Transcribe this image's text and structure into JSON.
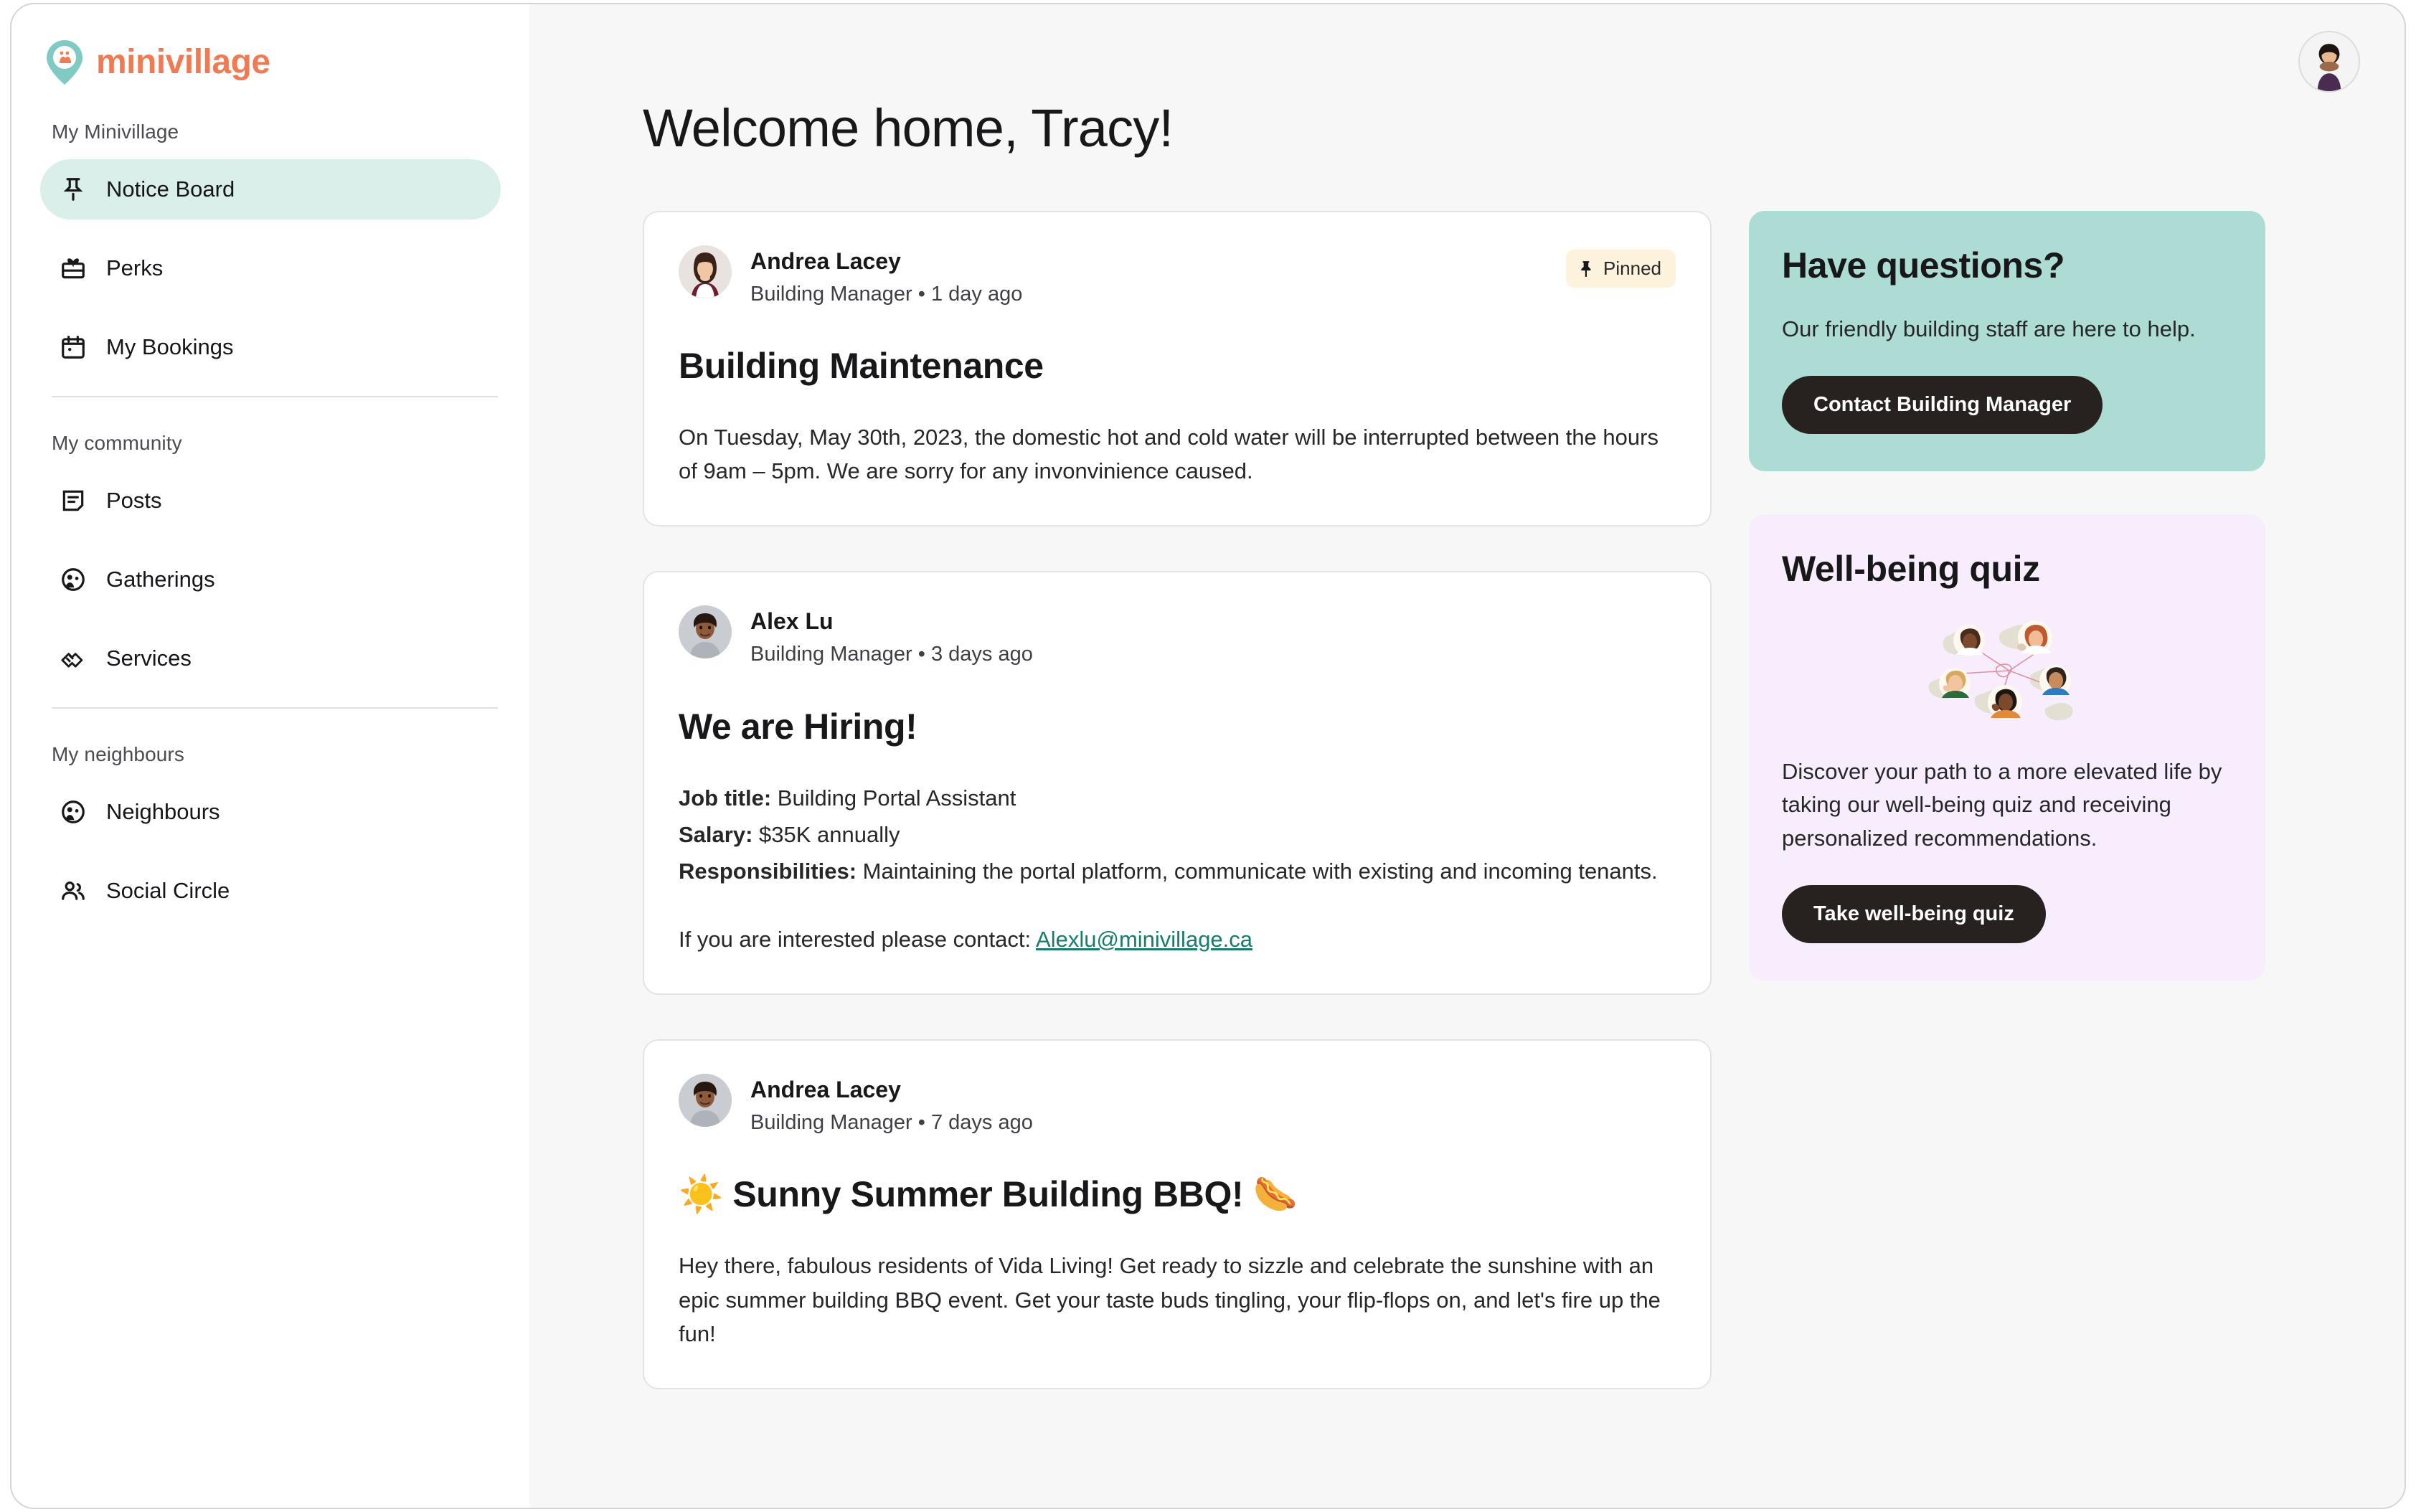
{
  "brand": {
    "name": "minivillage",
    "logo_icon": "map-pin-family-icon",
    "accent_color": "#F07B52",
    "pin_color": "#7FCBC4"
  },
  "sidebar": {
    "sections": [
      {
        "label": "My Minivillage",
        "items": [
          {
            "label": "Notice Board",
            "icon": "pushpin-icon",
            "active": true
          },
          {
            "label": "Perks",
            "icon": "gift-icon",
            "active": false
          },
          {
            "label": "My Bookings",
            "icon": "calendar-icon",
            "active": false
          }
        ]
      },
      {
        "label": "My community",
        "items": [
          {
            "label": "Posts",
            "icon": "note-icon",
            "active": false
          },
          {
            "label": "Gatherings",
            "icon": "users-circle-icon",
            "active": false
          },
          {
            "label": "Services",
            "icon": "handshake-icon",
            "active": false
          }
        ]
      },
      {
        "label": "My neighbours",
        "items": [
          {
            "label": "Neighbours",
            "icon": "users-circle-icon",
            "active": false
          },
          {
            "label": "Social Circle",
            "icon": "people-icon",
            "active": false
          }
        ]
      }
    ]
  },
  "topbar": {
    "avatar_icon": "user-avatar-photo"
  },
  "header": {
    "title": "Welcome home, Tracy!"
  },
  "posts": [
    {
      "author": "Andrea Lacey",
      "meta": "Building Manager • 1 day ago",
      "avatar_icon": "avatar-andrea-lacey",
      "pinned": true,
      "pinned_label": "Pinned",
      "title": "Building Maintenance",
      "body": "On Tuesday, May 30th, 2023, the domestic hot and cold water will be interrupted between the hours of 9am – 5pm. We are sorry for any invonvinience caused."
    },
    {
      "author": "Alex Lu",
      "meta": "Building Manager • 3 days ago",
      "avatar_icon": "avatar-alex-lu",
      "pinned": false,
      "title": "We are Hiring!",
      "job_title_label": "Job title:",
      "job_title_value": "Building Portal Assistant",
      "salary_label": "Salary:",
      "salary_value": "$35K annually",
      "responsibilities_label": "Responsibilities:",
      "responsibilities_value": "Maintaining the portal platform, communicate with existing and incoming tenants.",
      "contact_prefix": "If you are interested please contact:",
      "contact_email": "Alexlu@minivillage.ca"
    },
    {
      "author": "Andrea Lacey",
      "meta": "Building Manager • 7 days ago",
      "avatar_icon": "avatar-andrea-lacey-2",
      "pinned": false,
      "title": "☀️ Sunny Summer Building BBQ! 🌭",
      "body": "Hey there, fabulous residents of Vida Living! Get ready to sizzle and celebrate the sunshine with an epic summer building BBQ event. Get your taste buds tingling, your flip-flops on, and let's fire up the fun!"
    }
  ],
  "rail": {
    "questions_card": {
      "title": "Have questions?",
      "text": "Our friendly building staff are here to help.",
      "button_label": "Contact Building Manager",
      "bg_color": "#ACDCD3"
    },
    "quiz_card": {
      "title": "Well-being quiz",
      "illustration_icon": "connected-people-illustration",
      "text": "Discover your path to a more elevated life by taking our well-being quiz and receiving personalized recommendations.",
      "button_label": "Take well-being quiz",
      "bg_color": "#F8EDFC"
    }
  }
}
